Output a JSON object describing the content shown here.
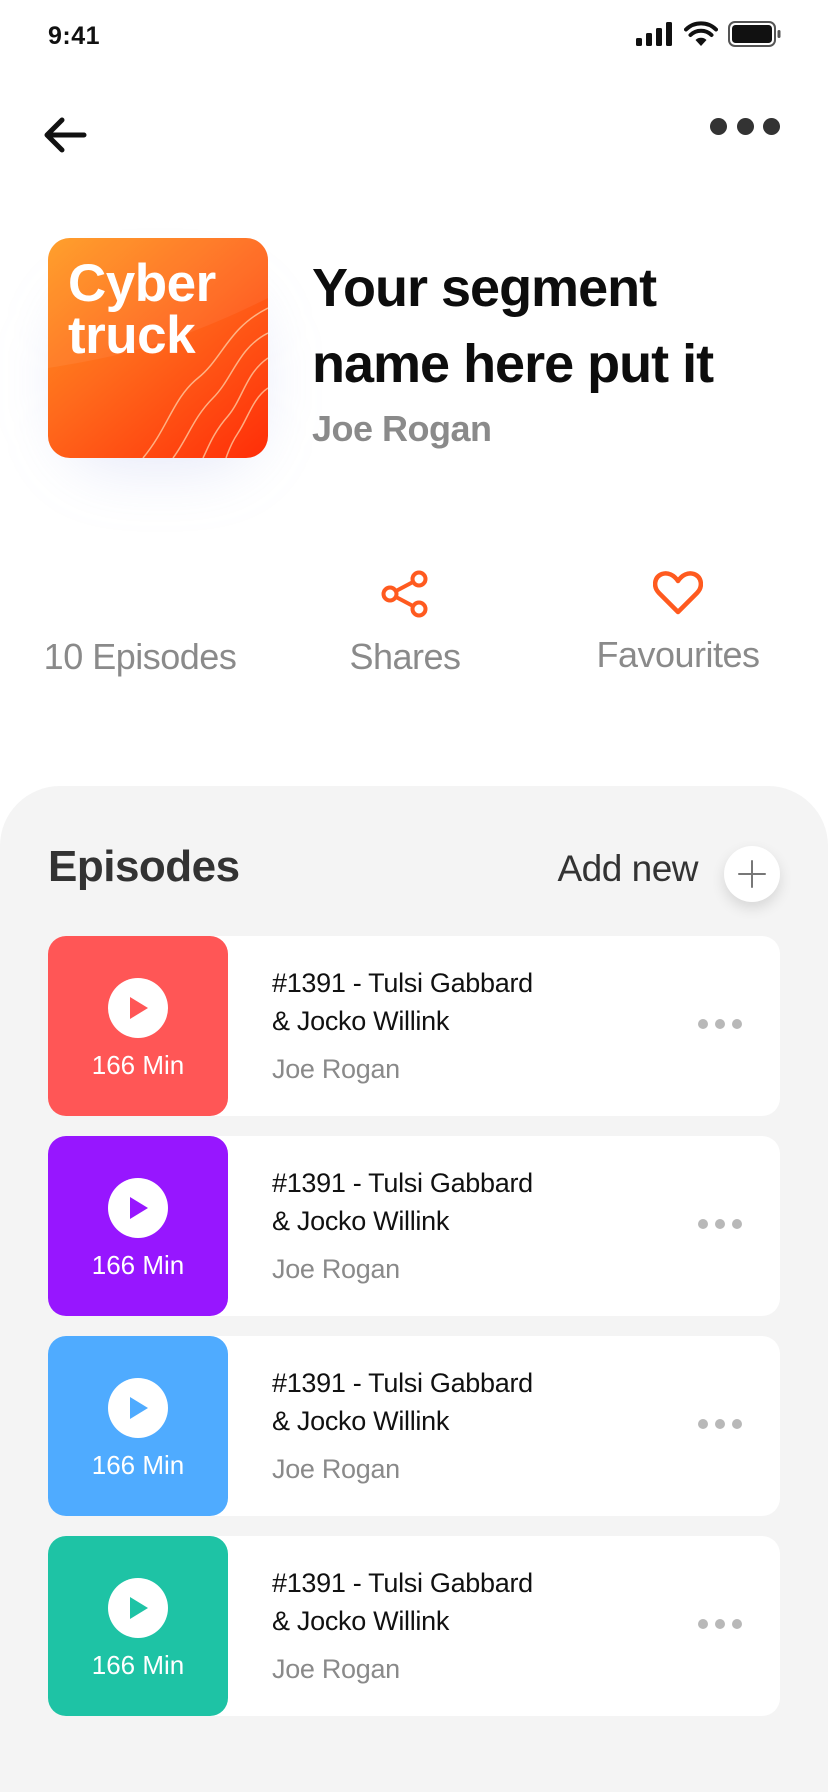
{
  "status_bar": {
    "time": "9:41",
    "icons": [
      "signal-icon",
      "wifi-icon",
      "battery-icon"
    ]
  },
  "nav": {
    "back_icon": "arrow-left-icon",
    "more_icon": "more-horizontal-icon"
  },
  "segment": {
    "cover_text": "Cyber\ntruck",
    "title": "Your segment\nname here put it",
    "author": "Joe Rogan"
  },
  "stats": {
    "episodes_label": "10 Episodes",
    "shares_label": "Shares",
    "favourites_label": "Favourites",
    "accent_color": "#ff5a1f"
  },
  "episodes_section": {
    "title": "Episodes",
    "add_new_label": "Add new",
    "items": [
      {
        "title": "#1391 - Tulsi Gabbard\n& Jocko Willink",
        "author": "Joe Rogan",
        "duration": "166 Min",
        "color": "#ff5656"
      },
      {
        "title": "#1391 - Tulsi Gabbard\n& Jocko Willink",
        "author": "Joe Rogan",
        "duration": "166 Min",
        "color": "#9716ff"
      },
      {
        "title": "#1391 - Tulsi Gabbard\n& Jocko Willink",
        "author": "Joe Rogan",
        "duration": "166 Min",
        "color": "#4fabff"
      },
      {
        "title": "#1391 - Tulsi Gabbard\n& Jocko Willink",
        "author": "Joe Rogan",
        "duration": "166 Min",
        "color": "#1ec3a5"
      }
    ]
  }
}
